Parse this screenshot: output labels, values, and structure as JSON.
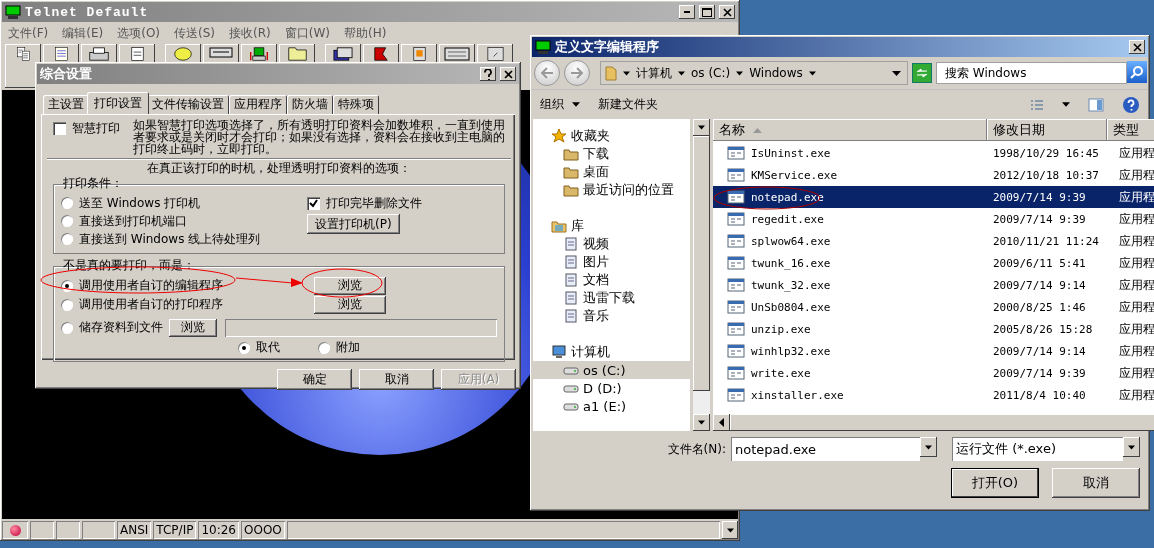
{
  "telnet_window": {
    "title": "Telnet Default",
    "menu": [
      "文件(F)",
      "编辑(E)",
      "选项(O)",
      "传送(S)",
      "接收(R)",
      "窗口(W)",
      "帮助(H)"
    ],
    "status_bar": [
      "ANSI",
      "TCP/IP",
      "10:26",
      "OOOO"
    ]
  },
  "settings_dialog": {
    "title": "综合设置",
    "tabs": [
      {
        "label": "主设置",
        "selected": false
      },
      {
        "label": "打印设置",
        "selected": true
      },
      {
        "label": "文件传输设置",
        "selected": false
      },
      {
        "label": "应用程序",
        "selected": false
      },
      {
        "label": "防火墙",
        "selected": false
      },
      {
        "label": "特殊项",
        "selected": false
      }
    ],
    "smart_print": {
      "label": "智慧打印",
      "checked": false,
      "description": "如果智慧打印选项选择了，所有透明打印资料会加数堆积，一直到使用者要求或是关闭时才会打印；如果没有选择，资料会在接收到主电脑的打印终止码时，立即打印。"
    },
    "heading": "在真正该打印的时机，处理透明打印资料的选项：",
    "print_conditions": {
      "title": "打印条件：",
      "options": [
        {
          "label": "送至 Windows 打印机",
          "selected": false
        },
        {
          "label": "直接送到打印机端口",
          "selected": false
        },
        {
          "label": "直接送到 Windows 线上待处理列",
          "selected": false
        }
      ],
      "delete_after_print": {
        "label": "打印完毕删除文件",
        "checked": true
      },
      "setup_button": "设置打印机(P)"
    },
    "instead": {
      "title": "不是真的要打印，而是：",
      "options": [
        {
          "kind": "program",
          "label": "调用使用者自订的编辑程序",
          "selected": true,
          "button": "浏览"
        },
        {
          "kind": "program",
          "label": "调用使用者自订的打印程序",
          "selected": false,
          "button": "浏览"
        },
        {
          "kind": "file",
          "label": "储存资料到文件",
          "selected": false,
          "button": "浏览"
        }
      ],
      "file_modes": [
        {
          "label": "取代",
          "selected": true
        },
        {
          "label": "附加",
          "selected": false
        }
      ]
    },
    "buttons": [
      {
        "label": "确定",
        "disabled": false
      },
      {
        "label": "取消",
        "disabled": false
      },
      {
        "label": "应用(A)",
        "disabled": true
      }
    ]
  },
  "file_dialog": {
    "title": "定义文字编辑程序",
    "path": [
      "计算机",
      "os (C:)",
      "Windows"
    ],
    "search": {
      "placeholder": "搜索 Windows"
    },
    "toolbar": [
      "组织",
      "新建文件夹"
    ],
    "nav": [
      {
        "label": "收藏夹",
        "selected": false,
        "children": [
          {
            "label": "下载",
            "selected": false
          },
          {
            "label": "桌面",
            "selected": false
          },
          {
            "label": "最近访问的位置",
            "selected": false
          }
        ]
      },
      {
        "label": "库",
        "selected": false,
        "children": [
          {
            "label": "视频",
            "selected": false
          },
          {
            "label": "图片",
            "selected": false
          },
          {
            "label": "文档",
            "selected": false
          },
          {
            "label": "迅雷下载",
            "selected": false
          },
          {
            "label": "音乐",
            "selected": false
          }
        ]
      },
      {
        "label": "计算机",
        "selected": false,
        "children": [
          {
            "label": "os (C:)",
            "selected": true
          },
          {
            "label": "D (D:)",
            "selected": false
          },
          {
            "label": "a1 (E:)",
            "selected": false
          }
        ]
      }
    ],
    "columns": [
      {
        "label": "名称",
        "sorted": true
      },
      {
        "label": "修改日期",
        "sorted": false
      },
      {
        "label": "类型",
        "sorted": false
      }
    ],
    "rows": [
      {
        "name": "IsUninst.exe",
        "date": "1998/10/29 16:45",
        "type": "应用程",
        "selected": false
      },
      {
        "name": "KMService.exe",
        "date": "2012/10/18 10:37",
        "type": "应用程",
        "selected": false
      },
      {
        "name": "notepad.exe",
        "date": "2009/7/14 9:39",
        "type": "应用程",
        "selected": true
      },
      {
        "name": "regedit.exe",
        "date": "2009/7/14 9:39",
        "type": "应用程",
        "selected": false
      },
      {
        "name": "splwow64.exe",
        "date": "2010/11/21 11:24",
        "type": "应用程",
        "selected": false
      },
      {
        "name": "twunk_16.exe",
        "date": "2009/6/11 5:41",
        "type": "应用程",
        "selected": false
      },
      {
        "name": "twunk_32.exe",
        "date": "2009/7/14 9:14",
        "type": "应用程",
        "selected": false
      },
      {
        "name": "UnSb0804.exe",
        "date": "2000/8/25 1:46",
        "type": "应用程",
        "selected": false
      },
      {
        "name": "unzip.exe",
        "date": "2005/8/26 15:28",
        "type": "应用程",
        "selected": false
      },
      {
        "name": "winhlp32.exe",
        "date": "2009/7/14 9:14",
        "type": "应用程",
        "selected": false
      },
      {
        "name": "write.exe",
        "date": "2009/7/14 9:39",
        "type": "应用程",
        "selected": false
      },
      {
        "name": "xinstaller.exe",
        "date": "2011/8/4 10:40",
        "type": "应用程",
        "selected": false
      }
    ],
    "file_name": {
      "label": "文件名(N):",
      "value": "notepad.exe"
    },
    "file_type": "运行文件 (*.exe)",
    "buttons": [
      "打开(O)",
      "取消"
    ]
  }
}
